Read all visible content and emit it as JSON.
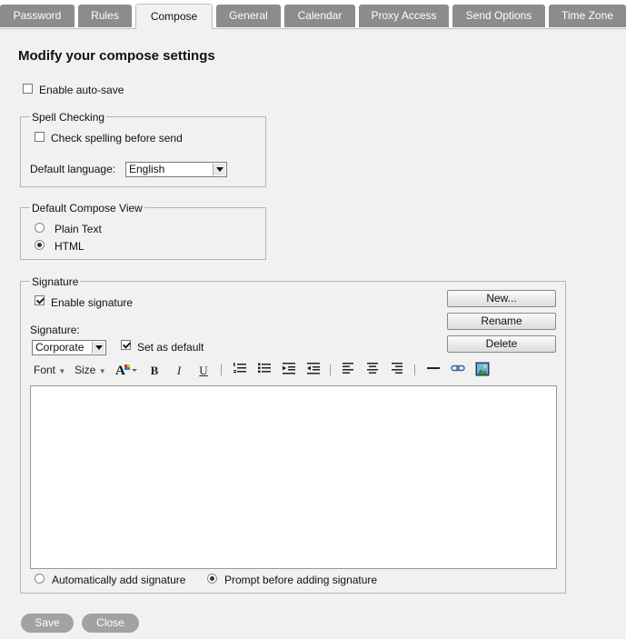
{
  "tabs": [
    {
      "label": "Password"
    },
    {
      "label": "Rules"
    },
    {
      "label": "Compose"
    },
    {
      "label": "General"
    },
    {
      "label": "Calendar"
    },
    {
      "label": "Proxy Access"
    },
    {
      "label": "Send Options"
    },
    {
      "label": "Time Zone"
    }
  ],
  "active_tab": "Compose",
  "page_title": "Modify your compose settings",
  "auto_save": {
    "label": "Enable auto-save",
    "checked": false
  },
  "spell": {
    "legend": "Spell Checking",
    "check_label": "Check spelling before send",
    "checked": false,
    "language_label": "Default language:",
    "language_value": "English"
  },
  "compose_view": {
    "legend": "Default Compose View",
    "options": [
      {
        "label": "Plain Text",
        "selected": false
      },
      {
        "label": "HTML",
        "selected": true
      }
    ]
  },
  "signature": {
    "legend": "Signature",
    "enable_label": "Enable signature",
    "enable_checked": true,
    "select_label": "Signature:",
    "select_value": "Corporate",
    "set_default_label": "Set as default",
    "set_default_checked": true,
    "buttons": {
      "new": "New...",
      "rename": "Rename",
      "delete": "Delete"
    },
    "toolbar": {
      "font": "Font",
      "size": "Size",
      "bold": "B",
      "italic": "I",
      "underline": "U"
    },
    "editor_content": "",
    "auto_add_options": [
      {
        "label": "Automatically add signature",
        "selected": false
      },
      {
        "label": "Prompt before adding signature",
        "selected": true
      }
    ]
  },
  "footer": {
    "save": "Save",
    "close": "Close"
  },
  "colors": {
    "tab_inactive": "#8c8c8c",
    "panel_bg": "#f1f1f1",
    "pill_button": "#a2a2a2"
  }
}
